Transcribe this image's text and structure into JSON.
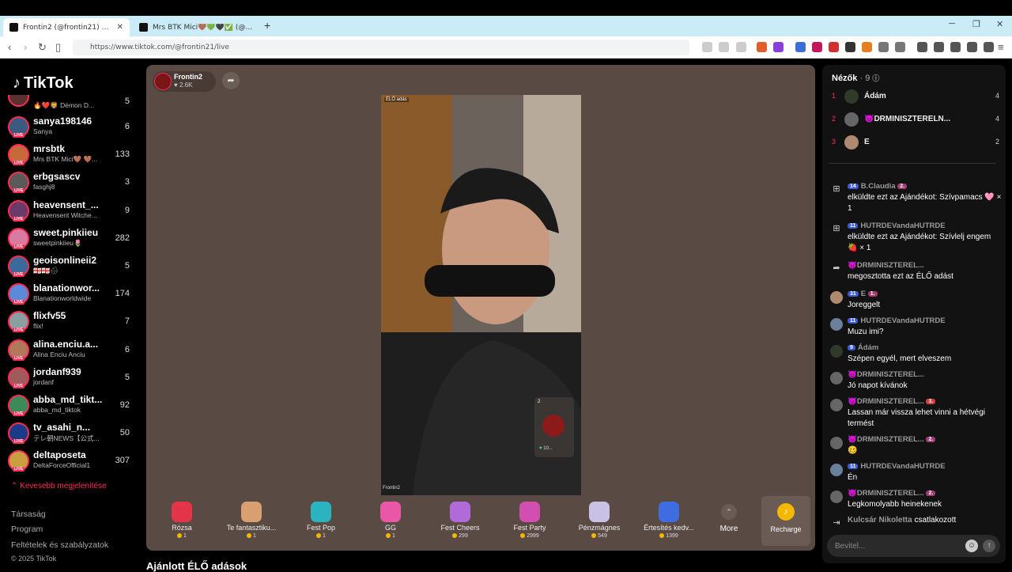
{
  "browser": {
    "tabs": [
      {
        "label": "Frontin2 (@frontin21) ÉLŐ adás",
        "active": true
      },
      {
        "label": "Mrs BTK Mici🤎💚🖤✅ (@mrsbtk) É",
        "active": false
      }
    ],
    "url": "https://www.tiktok.com/@frontin21/live"
  },
  "sidebar": {
    "logo": "TikTok",
    "top_partial": {
      "sub": "🔥❤️🦁 Dèmon D...",
      "count": "5"
    },
    "accounts": [
      {
        "name": "sanya198146",
        "sub": "Sanya",
        "count": "6"
      },
      {
        "name": "mrsbtk",
        "sub": "Mrs BTK Mici🤎 🤎...",
        "count": "133"
      },
      {
        "name": "erbgsascv",
        "sub": "fasghj8",
        "count": "3"
      },
      {
        "name": "heavensent_...",
        "sub": "Heavensent Witche...",
        "count": "9"
      },
      {
        "name": "sweet.pinkiieu",
        "sub": "sweetpinkiieu🌷",
        "count": "282"
      },
      {
        "name": "geoisonlineii2",
        "sub": "🇬🇪🇬🇪🌧",
        "count": "5"
      },
      {
        "name": "blanationwor...",
        "sub": "Blanationworldwide",
        "count": "174"
      },
      {
        "name": "flixfv55",
        "sub": "flix!",
        "count": "7"
      },
      {
        "name": "alina.enciu.a...",
        "sub": "Alina Enciu Anciu",
        "count": "6"
      },
      {
        "name": "jordanf939",
        "sub": "jordanf",
        "count": "5"
      },
      {
        "name": "abba_md_tikt...",
        "sub": "abba_md_tiktok",
        "count": "92"
      },
      {
        "name": "tv_asahi_n...",
        "sub": "テレ朝NEWS【公式...",
        "count": "50"
      },
      {
        "name": "deltaposeta",
        "sub": "DeltaForceOfficial1",
        "count": "307"
      }
    ],
    "less_label": "Kevesebb megjelenítése",
    "footer": [
      "Társaság",
      "Program",
      "Feltételek és szabályzatok"
    ],
    "copyright": "© 2025 TikTok"
  },
  "stage": {
    "host_name": "Frontin2",
    "host_likes": "2.6K",
    "live_label": "ÉLŐ adás",
    "watermark": "Frontin2",
    "mini_count": "2",
    "mini_likes": "10..."
  },
  "gifts": [
    {
      "name": "Rózsa",
      "price": "1"
    },
    {
      "name": "Te fantasztiku...",
      "price": "1"
    },
    {
      "name": "Fest Pop",
      "price": "1"
    },
    {
      "name": "GG",
      "price": "1"
    },
    {
      "name": "Fest Cheers",
      "price": "299"
    },
    {
      "name": "Fest Party",
      "price": "2999"
    },
    {
      "name": "Pénzmágnes",
      "price": "549"
    },
    {
      "name": "Értesítés kedv...",
      "price": "1399"
    }
  ],
  "more_label": "More",
  "recharge_label": "Recharge",
  "bottom_title": "Ajánlott ÉLŐ adások",
  "chat": {
    "viewers_label": "Nézők",
    "viewers_count": "· 9",
    "top_viewers": [
      {
        "rank": "1",
        "name": "Ádám",
        "score": "4"
      },
      {
        "rank": "2",
        "name": "😈DRMINISZTERELN...",
        "score": "4"
      },
      {
        "rank": "3",
        "name": "E",
        "score": "2"
      }
    ],
    "messages": [
      {
        "badge": "14",
        "user": "B.Claudia",
        "rank": "2.",
        "text": "elküldte ezt az Ajándékot: Szívpamacs 🩷 × 1"
      },
      {
        "badge": "11",
        "user": "HUTRDEVandaHUTRDE",
        "text": "elküldte ezt az Ajándékot: Szívlelj engem 🍓 × 1"
      },
      {
        "user": "😈DRMINISZTEREL...",
        "text": "megosztotta ezt az ÉLŐ adást"
      },
      {
        "badge": "31",
        "user": "E",
        "rank": "1.",
        "text": "Joreggelt"
      },
      {
        "badge": "11",
        "user": "HUTRDEVandaHUTRDE",
        "text": "Muzu imi?"
      },
      {
        "badge": "9",
        "user": "Ádám",
        "text": "Szépen egyél, mert elveszem"
      },
      {
        "user": "😈DRMINISZTEREL...",
        "text": "Jó napot kívánok"
      },
      {
        "user": "😈DRMINISZTEREL...",
        "rank": "3.",
        "text": "Lassan már vissza lehet vinni a hétvégi termést"
      },
      {
        "user": "😈DRMINISZTEREL...",
        "rank": "2.",
        "text": "🥴"
      },
      {
        "badge": "11",
        "user": "HUTRDEVandaHUTRDE",
        "text": "Én"
      },
      {
        "user": "😈DRMINISZTEREL...",
        "rank": "2.",
        "text": "Legkomolyabb heinekenek"
      }
    ],
    "joined_user": "Kulcsár Nikoletta",
    "joined_text": "csatlakozott",
    "input_placeholder": "Bevitel..."
  }
}
